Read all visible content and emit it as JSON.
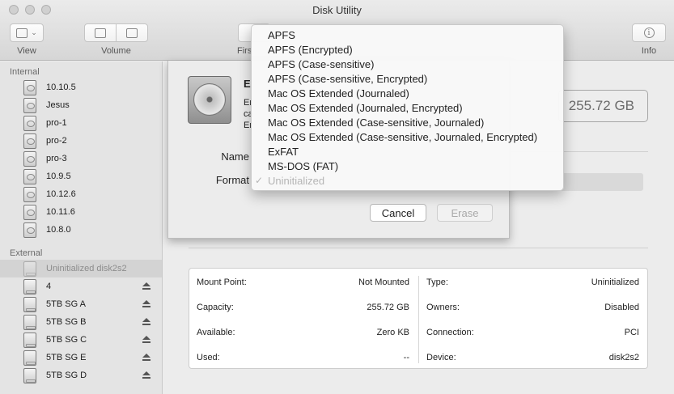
{
  "window": {
    "title": "Disk Utility"
  },
  "toolbar": {
    "view_label": "View",
    "volume_label": "Volume",
    "first_aid_label": "Firs",
    "info_label": "Info"
  },
  "sidebar": {
    "internal_header": "Internal",
    "internal": [
      {
        "label": "10.10.5"
      },
      {
        "label": "Jesus"
      },
      {
        "label": "pro-1"
      },
      {
        "label": "pro-2"
      },
      {
        "label": "pro-3"
      },
      {
        "label": "10.9.5"
      },
      {
        "label": "10.12.6"
      },
      {
        "label": "10.11.6"
      },
      {
        "label": "10.8.0"
      }
    ],
    "external_header": "External",
    "external": [
      {
        "label": "Uninitialized disk2s2"
      },
      {
        "label": "4"
      },
      {
        "label": "5TB SG A"
      },
      {
        "label": "5TB SG B"
      },
      {
        "label": "5TB SG C"
      },
      {
        "label": "5TB SG E"
      },
      {
        "label": "5TB SG D"
      }
    ]
  },
  "main": {
    "capacity": "255.72 GB",
    "info": {
      "mount_point_label": "Mount Point:",
      "mount_point_value": "Not Mounted",
      "capacity_label": "Capacity:",
      "capacity_value": "255.72 GB",
      "available_label": "Available:",
      "available_value": "Zero KB",
      "used_label": "Used:",
      "used_value": "--",
      "type_label": "Type:",
      "type_value": "Uninitialized",
      "owners_label": "Owners:",
      "owners_value": "Disabled",
      "connection_label": "Connection:",
      "connection_value": "PCI",
      "device_label": "Device:",
      "device_value": "disk2s2"
    }
  },
  "sheet": {
    "title": "E",
    "line1": "Er",
    "line2": "ca",
    "line3": "Er",
    "name_label": "Name",
    "format_label": "Format",
    "cancel_label": "Cancel",
    "erase_label": "Erase"
  },
  "format_menu": {
    "items": [
      "APFS",
      "APFS (Encrypted)",
      "APFS (Case-sensitive)",
      "APFS (Case-sensitive, Encrypted)",
      "Mac OS Extended (Journaled)",
      "Mac OS Extended (Journaled, Encrypted)",
      "Mac OS Extended (Case-sensitive, Journaled)",
      "Mac OS Extended (Case-sensitive, Journaled, Encrypted)",
      "ExFAT",
      "MS-DOS (FAT)"
    ],
    "selected": "Uninitialized",
    "checkmark": "✓"
  }
}
